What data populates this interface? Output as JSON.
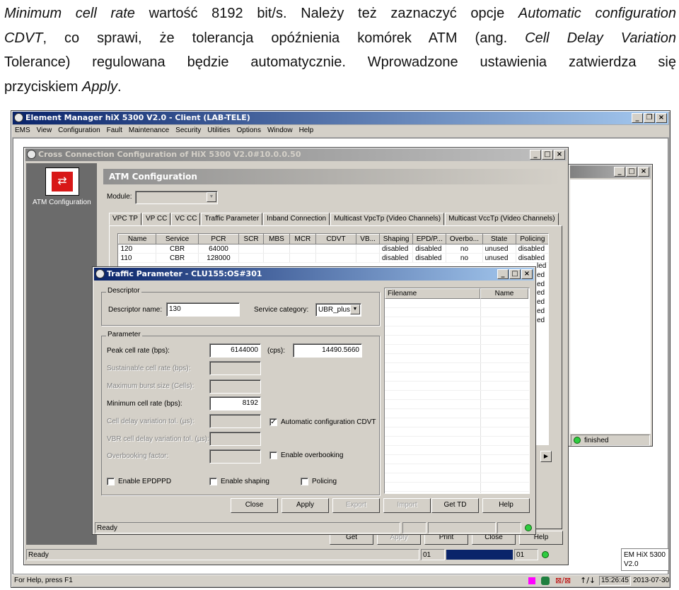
{
  "document": {
    "line1_a": "Minimum cell rate",
    "line1_b": " wartość 8192 bit/s. Należy też zaznaczyć opcje ",
    "line1_c": "Automatic configuration",
    "line2_a": "CDVT",
    "line2_b": ", co sprawi, że tolerancja opóźnienia komórek ATM (ang. ",
    "line2_c": "Cell Delay Variation",
    "line3": "Tolerance) regulowana będzie automatycznie. Wprowadzone ustawienia zatwierdza się",
    "line4_a": "przyciskiem ",
    "line4_b": "Apply",
    "line4_c": "."
  },
  "main_window": {
    "title": "Element Manager hiX 5300 V2.0 - Client (LAB-TELE)",
    "menu": [
      "EMS",
      "View",
      "Configuration",
      "Fault",
      "Maintenance",
      "Security",
      "Utilities",
      "Options",
      "Window",
      "Help"
    ],
    "status_help": "For Help, press F1",
    "clock": "15:26:45",
    "date": "2013-07-30"
  },
  "cross_window": {
    "title": "Cross Connection Configuration of HiX 5300 V2.0#10.0.0.50",
    "sidebar_label": "ATM Configuration",
    "panel_title": "ATM Configuration",
    "module_label": "Module:",
    "tabs": [
      "VPC TP",
      "VP CC",
      "VC CC",
      "Traffic Parameter",
      "Inband Connection",
      "Multicast VpcTp (Video Channels)",
      "Multicast VccTp (Video Channels)"
    ],
    "columns": [
      "Name",
      "Service",
      "PCR",
      "SCR",
      "MBS",
      "MCR",
      "CDVT",
      "VB...",
      "Shaping",
      "EPD/P...",
      "Overbo...",
      "State",
      "Policing"
    ],
    "rows": [
      [
        "120",
        "CBR",
        "64000",
        "",
        "",
        "",
        "",
        "",
        "disabled",
        "disabled",
        "no",
        "unused",
        "disabled"
      ],
      [
        "110",
        "CBR",
        "128000",
        "",
        "",
        "",
        "",
        "",
        "disabled",
        "disabled",
        "no",
        "unused",
        "disabled"
      ]
    ],
    "partial_rows": [
      "led",
      "ed",
      "ed",
      "ed",
      "ed",
      "ed",
      "ed"
    ],
    "bottom_buttons": [
      "Get",
      "Apply",
      "Print",
      "Close",
      "Help"
    ],
    "status_ready": "Ready",
    "field_a": "01",
    "field_b": "01",
    "version": "EM HiX 5300\nV2.0"
  },
  "back_window": {
    "status": "finished"
  },
  "dialog": {
    "title": "Traffic Parameter - CLU155:OS#301",
    "descriptor_group": "Descriptor",
    "descriptor_name_label": "Descriptor name:",
    "descriptor_name_value": "130",
    "service_category_label": "Service category:",
    "service_category_value": "UBR_plus",
    "parameter_group": "Parameter",
    "pcr_label": "Peak cell rate (bps):",
    "pcr_value": "6144000",
    "cps_label": "(cps):",
    "cps_value": "14490.5660",
    "scr_label": "Sustainable cell rate (bps):",
    "mbs_label": "Maximum burst size (Cells):",
    "mcr_label": "Minimum cell rate (bps):",
    "mcr_value": "8192",
    "cdvt_label": "Cell delay variation tol. (µs):",
    "auto_cdvt_label": "Automatic configuration CDVT",
    "vbr_cdvt_label": "VBR cell delay variation tol. (µs):",
    "overbooking_label": "Overbooking factor:",
    "enable_overbooking_label": "Enable overbooking",
    "enable_epdppd_label": "Enable EPDPPD",
    "enable_shaping_label": "Enable shaping",
    "policing_label": "Policing",
    "file_columns": [
      "Filename",
      "Name"
    ],
    "buttons": [
      "Close",
      "Apply",
      "Export",
      "Import",
      "Get TD",
      "Help"
    ],
    "status_ready": "Ready"
  }
}
